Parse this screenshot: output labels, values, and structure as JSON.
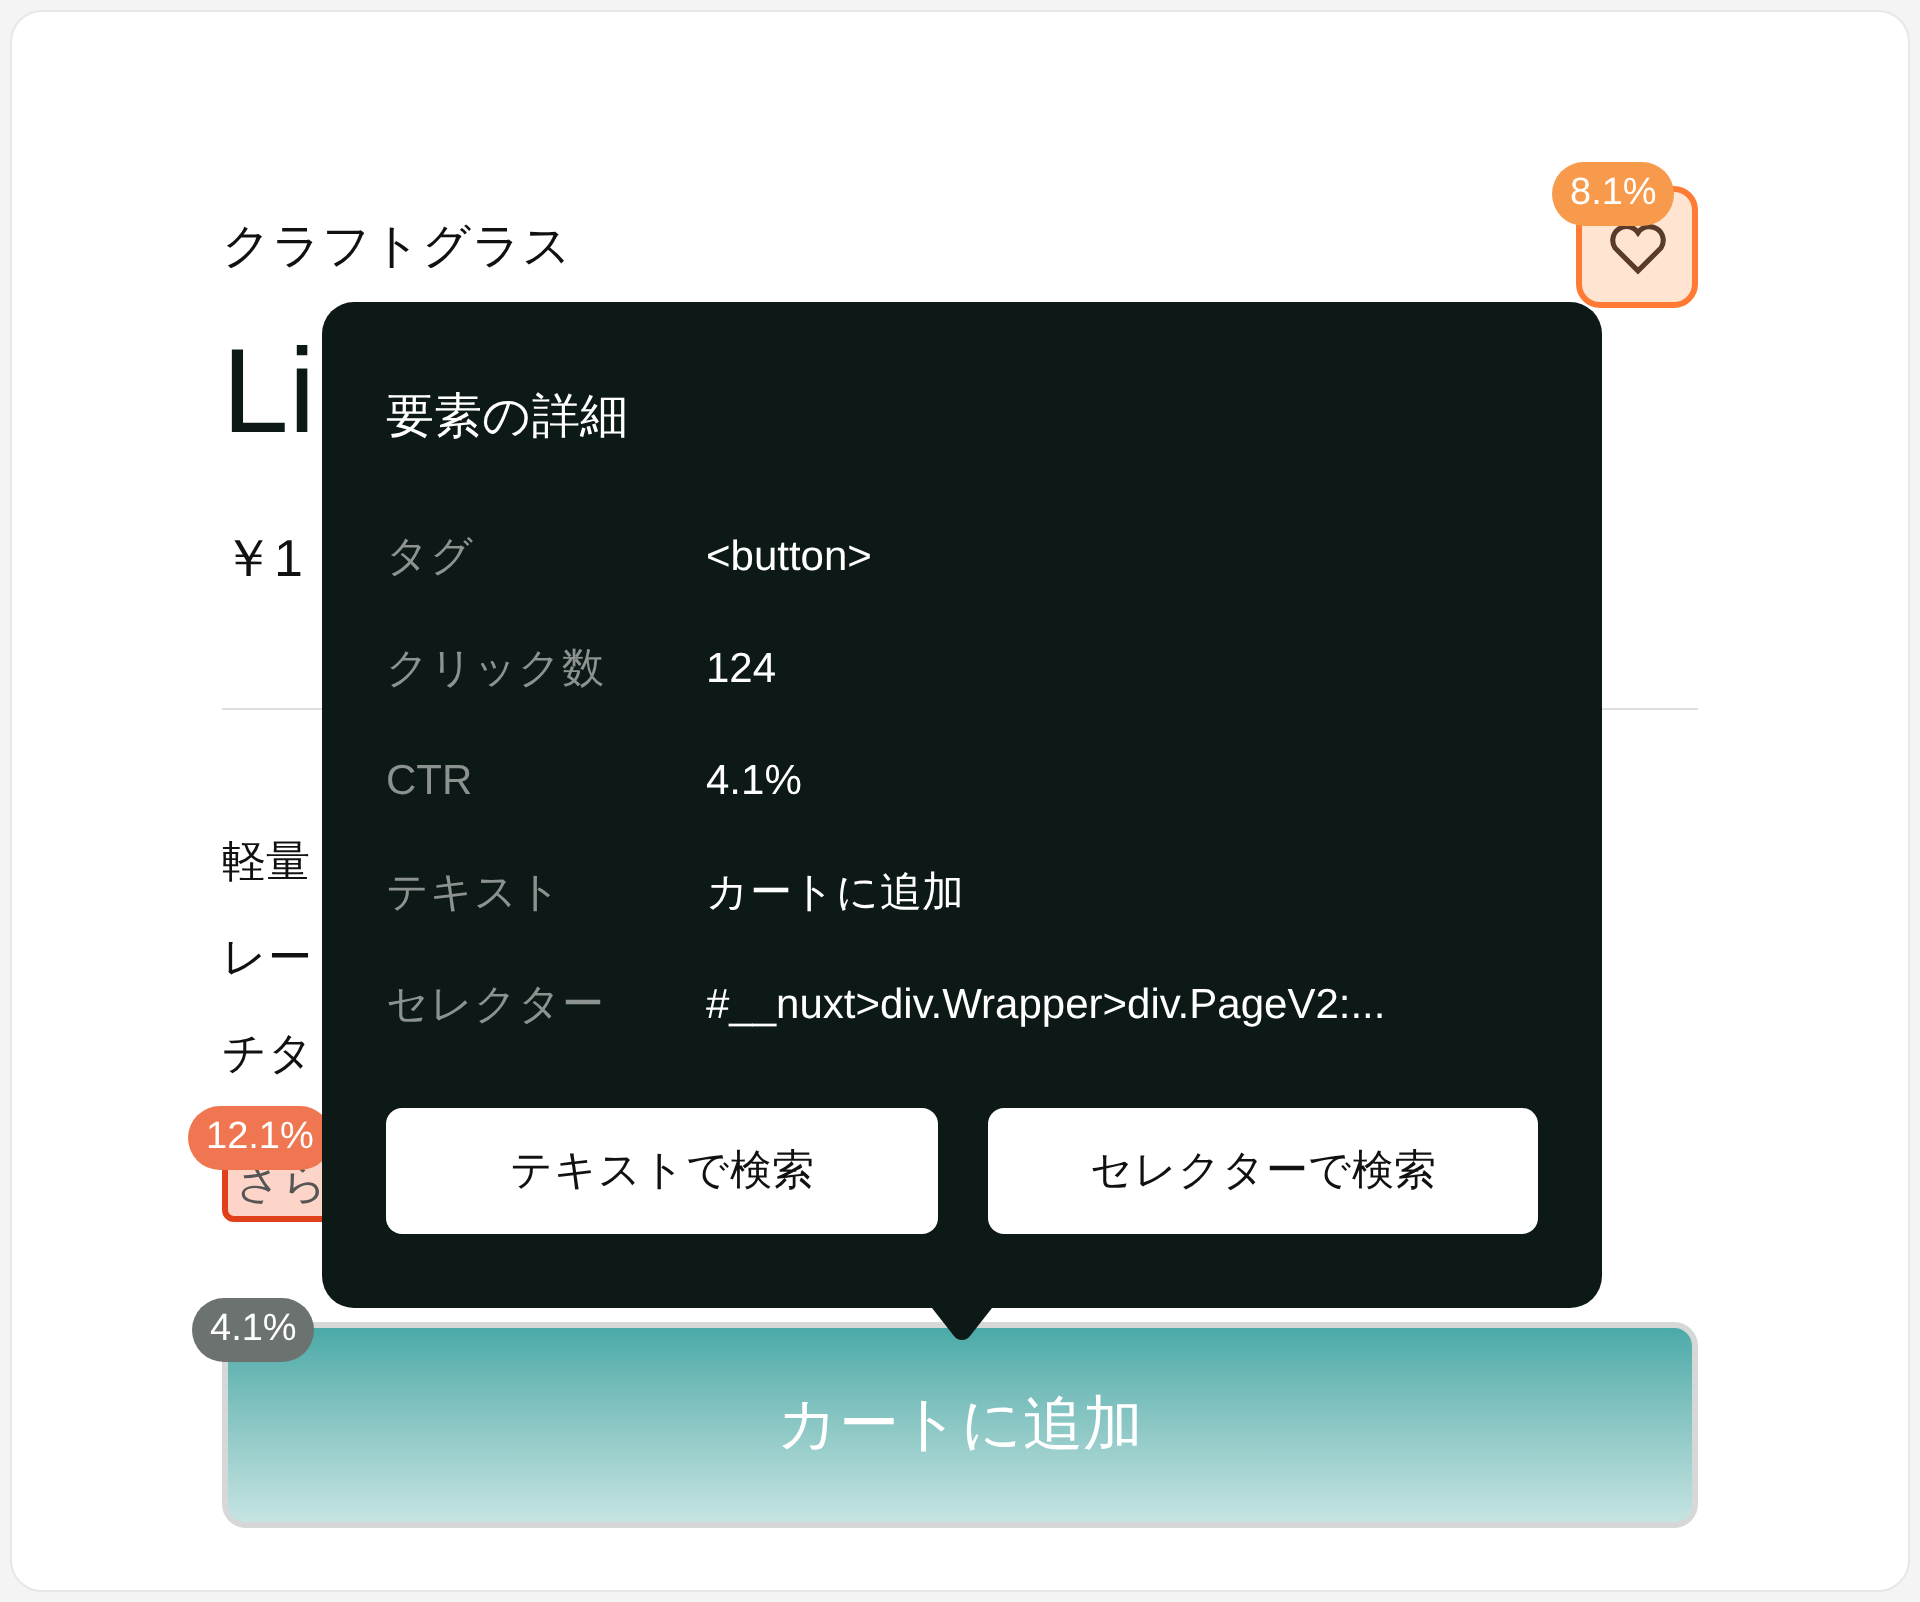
{
  "product": {
    "brand": "クラフトグラス",
    "title": "Li",
    "price": "￥1",
    "description_lines": [
      "軽量",
      "レー",
      "チタ"
    ],
    "link": "さら"
  },
  "favorite_button": {
    "heat_badge": {
      "text": "8.1%",
      "color": "#f79a4c"
    }
  },
  "link_heat_badge": {
    "text": "12.1%",
    "color": "#ef7650"
  },
  "cart_button": {
    "label": "カートに追加",
    "heat_badge": {
      "text": "4.1%",
      "color": "#6b7270"
    }
  },
  "popover": {
    "title": "要素の詳細",
    "rows": [
      {
        "label": "タグ",
        "value": "<button>"
      },
      {
        "label": "クリック数",
        "value": "124"
      },
      {
        "label": "CTR",
        "value": "4.1%"
      },
      {
        "label": "テキスト",
        "value": "カートに追加"
      },
      {
        "label": "セレクター",
        "value": "#__nuxt>div.Wrapper>div.PageV2:..."
      }
    ],
    "buttons": [
      "テキストで検索",
      "セレクターで検索"
    ]
  }
}
